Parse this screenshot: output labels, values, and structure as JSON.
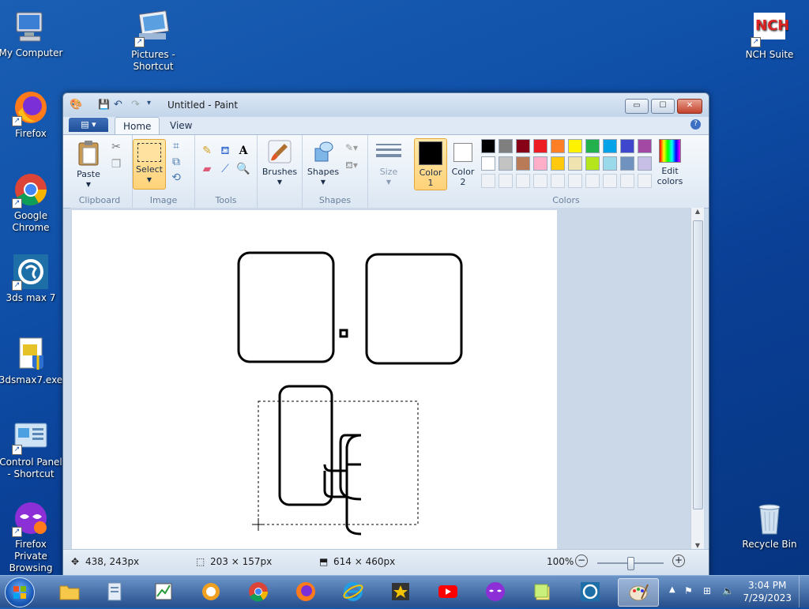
{
  "desktop": {
    "icons": [
      {
        "label": "My Computer"
      },
      {
        "label": "Pictures - Shortcut"
      },
      {
        "label": "NCH Suite"
      },
      {
        "label": "Firefox"
      },
      {
        "label": "Google Chrome"
      },
      {
        "label": "3ds max 7"
      },
      {
        "label": "3dsmax7.exe"
      },
      {
        "label": "Control Panel - Shortcut"
      },
      {
        "label": "Firefox Private Browsing"
      },
      {
        "label": "Recycle Bin"
      }
    ]
  },
  "window": {
    "title": "Untitled - Paint",
    "controls": {
      "minimize": "▭",
      "maximize": "☐",
      "close": "✕"
    }
  },
  "ribbon": {
    "tabs": [
      "Home",
      "View"
    ],
    "active_tab": "Home",
    "groups": {
      "clipboard": {
        "label": "Clipboard",
        "paste": "Paste"
      },
      "image": {
        "label": "Image",
        "select": "Select"
      },
      "tools": {
        "label": "Tools"
      },
      "brushes": {
        "label": "Brushes"
      },
      "shapes": {
        "label": "Shapes",
        "button": "Shapes"
      },
      "size": {
        "label": "Size"
      },
      "color1": {
        "label": "Color",
        "num": "1",
        "value": "#000000"
      },
      "color2": {
        "label": "Color",
        "num": "2",
        "value": "#ffffff"
      },
      "colors": {
        "label": "Colors"
      },
      "edit_colors": {
        "label": "Edit colors"
      }
    },
    "palette_row1": [
      "#000000",
      "#7f7f7f",
      "#880015",
      "#ed1c24",
      "#ff7f27",
      "#fff200",
      "#22b14c",
      "#00a2e8",
      "#3f48cc",
      "#a349a4"
    ],
    "palette_row2": [
      "#ffffff",
      "#c3c3c3",
      "#b97a57",
      "#ffaec9",
      "#ffc90e",
      "#efe4b0",
      "#b5e61d",
      "#99d9ea",
      "#7092be",
      "#c8bfe7"
    ]
  },
  "status": {
    "cursor": "438, 243px",
    "selection": "203 × 157px",
    "image_size": "614 × 460px",
    "zoom": "100%",
    "zoom_fraction": 0.5
  },
  "taskbar": {
    "time": "3:04 PM",
    "date": "7/29/2023"
  }
}
